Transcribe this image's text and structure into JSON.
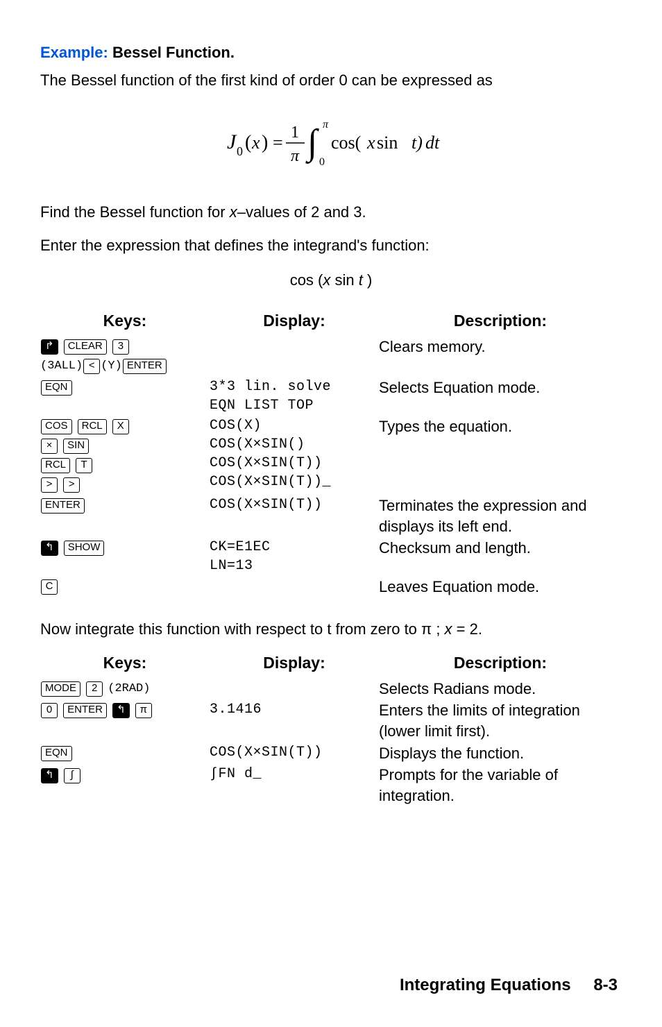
{
  "example": {
    "label": "Example:",
    "title": "Bessel Function."
  },
  "intro": "The Bessel function of the first kind of order 0 can be expressed as",
  "formula_svg_text": {
    "J": "J",
    "zero": "0",
    "x": "x",
    "eq": "=",
    "one": "1",
    "pi": "π",
    "int_low": "0",
    "int_high": "π",
    "cos": "cos(",
    "sin": " sin ",
    "tparen": "t)",
    "dt": "dt"
  },
  "find_line_a": "Find the Bessel function for ",
  "find_line_b": "x",
  "find_line_c": "–values of 2 and 3.",
  "enter_line": "Enter the expression that defines the integrand's function:",
  "center_expr_a": "cos (",
  "center_expr_b": "x",
  "center_expr_c": " sin ",
  "center_expr_d": "t",
  "center_expr_e": " )",
  "table_headers": {
    "keys": "Keys:",
    "display": "Display:",
    "description": "Description:"
  },
  "t1": {
    "r1": {
      "k_shift": "↱",
      "k_clear": "CLEAR",
      "k_3": "3",
      "display": "",
      "desc": "Clears memory."
    },
    "r2": {
      "raw_a": "(3ALL)",
      "k_left": "<",
      "raw_b": "(Y)",
      "k_enter": "ENTER",
      "k_eqn": "EQN",
      "disp1": "3*3 lin. solve",
      "disp2": "EQN LIST TOP",
      "desc": "Selects Equation mode."
    },
    "r3": {
      "k_cos": "COS",
      "k_rcl": "RCL",
      "k_x": "X",
      "k_mul": "×",
      "k_sin": "SIN",
      "k_rcl2": "RCL",
      "k_t": "T",
      "k_r1": ">",
      "k_r2": ">",
      "disp1": "COS(X)",
      "disp2": "COS(X×SIN()",
      "disp3": "COS(X×SIN(T))",
      "disp4": "COS(X×SIN(T))_",
      "desc": "Types the equation."
    },
    "r4": {
      "k_enter": "ENTER",
      "disp": "COS(X×SIN(T))",
      "desc": "Terminates the expression and displays its left end."
    },
    "r5": {
      "k_shift": "↰",
      "k_show": "SHOW",
      "disp1": "CK=E1EC",
      "disp2": "LN=13",
      "desc": "Checksum and length."
    },
    "r6": {
      "k_c": "C",
      "desc": "Leaves Equation mode."
    }
  },
  "mid_line_a": "Now integrate this function with respect to t from zero to π ; ",
  "mid_line_b": "x",
  "mid_line_c": " = 2.",
  "t2": {
    "r1": {
      "k_mode": "MODE",
      "k_2": "2",
      "raw": "(2RAD)",
      "desc": "Selects Radians mode."
    },
    "r2": {
      "k_0": "0",
      "k_enter": "ENTER",
      "k_shift": "↰",
      "k_pi": "π",
      "disp": "3.1416",
      "desc": "Enters the limits of integration (lower limit first)."
    },
    "r3": {
      "k_eqn": "EQN",
      "disp": "COS(X×SIN(T))",
      "desc": "Displays the function."
    },
    "r4": {
      "k_shift": "↰",
      "k_int": "∫",
      "disp": "∫FN d_",
      "desc": "Prompts for the variable of integration."
    }
  },
  "footer": {
    "title": "Integrating Equations",
    "page": "8-3"
  }
}
